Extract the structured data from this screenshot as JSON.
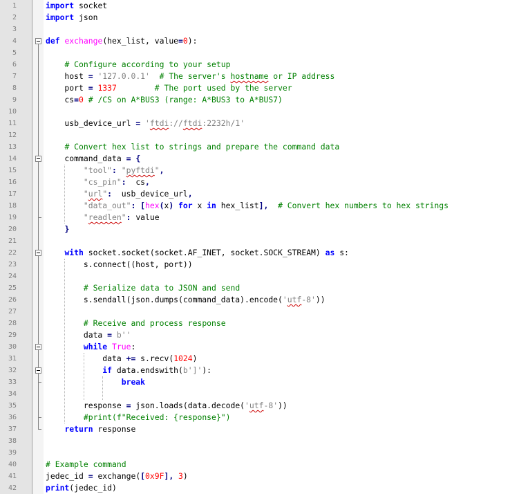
{
  "editor": {
    "line_numbers": [
      "1",
      "2",
      "3",
      "4",
      "5",
      "6",
      "7",
      "8",
      "9",
      "10",
      "11",
      "12",
      "13",
      "14",
      "15",
      "16",
      "17",
      "18",
      "19",
      "20",
      "21",
      "22",
      "23",
      "24",
      "25",
      "26",
      "27",
      "28",
      "29",
      "30",
      "31",
      "32",
      "33",
      "34",
      "35",
      "36",
      "37",
      "38",
      "39",
      "40",
      "41",
      "42"
    ],
    "lines": [
      [
        {
          "t": "kw",
          "v": "import"
        },
        {
          "t": "",
          "v": " socket"
        }
      ],
      [
        {
          "t": "kw",
          "v": "import"
        },
        {
          "t": "",
          "v": " json"
        }
      ],
      [],
      [
        {
          "t": "kw",
          "v": "def"
        },
        {
          "t": "",
          "v": " "
        },
        {
          "t": "fn",
          "v": "exchange"
        },
        {
          "t": "",
          "v": "(hex_list, value"
        },
        {
          "t": "op",
          "v": "="
        },
        {
          "t": "num",
          "v": "0"
        },
        {
          "t": "",
          "v": "):"
        }
      ],
      [],
      [
        {
          "t": "",
          "v": "    "
        },
        {
          "t": "com",
          "v": "# Configure according to your setup"
        }
      ],
      [
        {
          "t": "",
          "v": "    host "
        },
        {
          "t": "op",
          "v": "="
        },
        {
          "t": "",
          "v": " "
        },
        {
          "t": "str",
          "v": "'127.0.0.1'"
        },
        {
          "t": "",
          "v": "  "
        },
        {
          "t": "com",
          "v": "# The server's "
        },
        {
          "t": "com sq",
          "v": "hostname"
        },
        {
          "t": "com",
          "v": " or IP address"
        }
      ],
      [
        {
          "t": "",
          "v": "    port "
        },
        {
          "t": "op",
          "v": "="
        },
        {
          "t": "",
          "v": " "
        },
        {
          "t": "num",
          "v": "1337"
        },
        {
          "t": "",
          "v": "        "
        },
        {
          "t": "com",
          "v": "# The port used by the server"
        }
      ],
      [
        {
          "t": "",
          "v": "    cs"
        },
        {
          "t": "op",
          "v": "="
        },
        {
          "t": "num",
          "v": "0"
        },
        {
          "t": "",
          "v": " "
        },
        {
          "t": "com",
          "v": "# /CS on A*BUS3 (range: A*BUS3 to A*BUS7)"
        }
      ],
      [],
      [
        {
          "t": "",
          "v": "    usb_device_url "
        },
        {
          "t": "op",
          "v": "="
        },
        {
          "t": "",
          "v": " "
        },
        {
          "t": "str",
          "v": "'"
        },
        {
          "t": "str sq",
          "v": "ftdi"
        },
        {
          "t": "str",
          "v": "://"
        },
        {
          "t": "str sq",
          "v": "ftdi"
        },
        {
          "t": "str",
          "v": ":2232h/1'"
        }
      ],
      [],
      [
        {
          "t": "",
          "v": "    "
        },
        {
          "t": "com",
          "v": "# Convert hex list to strings and prepare the command data"
        }
      ],
      [
        {
          "t": "",
          "v": "    command_data "
        },
        {
          "t": "op",
          "v": "="
        },
        {
          "t": "",
          "v": " "
        },
        {
          "t": "op",
          "v": "{"
        }
      ],
      [
        {
          "t": "",
          "v": "        "
        },
        {
          "t": "str",
          "v": "\"tool\""
        },
        {
          "t": "op",
          "v": ":"
        },
        {
          "t": "",
          "v": " "
        },
        {
          "t": "str",
          "v": "\""
        },
        {
          "t": "str sq",
          "v": "pyftdi"
        },
        {
          "t": "str",
          "v": "\""
        },
        {
          "t": "op",
          "v": ","
        }
      ],
      [
        {
          "t": "",
          "v": "        "
        },
        {
          "t": "str",
          "v": "\"cs_pin\""
        },
        {
          "t": "op",
          "v": ":"
        },
        {
          "t": "",
          "v": "  cs"
        },
        {
          "t": "op",
          "v": ","
        }
      ],
      [
        {
          "t": "",
          "v": "        "
        },
        {
          "t": "str",
          "v": "\""
        },
        {
          "t": "str sq",
          "v": "url"
        },
        {
          "t": "str",
          "v": "\""
        },
        {
          "t": "op",
          "v": ":"
        },
        {
          "t": "",
          "v": "  usb_device_url"
        },
        {
          "t": "op",
          "v": ","
        }
      ],
      [
        {
          "t": "",
          "v": "        "
        },
        {
          "t": "str",
          "v": "\"data_out\""
        },
        {
          "t": "op",
          "v": ":"
        },
        {
          "t": "",
          "v": " "
        },
        {
          "t": "op",
          "v": "["
        },
        {
          "t": "fn",
          "v": "hex"
        },
        {
          "t": "op",
          "v": "("
        },
        {
          "t": "",
          "v": "x"
        },
        {
          "t": "op",
          "v": ")"
        },
        {
          "t": "",
          "v": " "
        },
        {
          "t": "kw",
          "v": "for"
        },
        {
          "t": "",
          "v": " x "
        },
        {
          "t": "kw",
          "v": "in"
        },
        {
          "t": "",
          "v": " hex_list"
        },
        {
          "t": "op",
          "v": "],"
        },
        {
          "t": "",
          "v": "  "
        },
        {
          "t": "com",
          "v": "# Convert hex numbers to hex strings"
        }
      ],
      [
        {
          "t": "",
          "v": "        "
        },
        {
          "t": "str",
          "v": "\""
        },
        {
          "t": "str sq",
          "v": "readlen"
        },
        {
          "t": "str",
          "v": "\""
        },
        {
          "t": "op",
          "v": ":"
        },
        {
          "t": "",
          "v": " value"
        }
      ],
      [
        {
          "t": "",
          "v": "    "
        },
        {
          "t": "op",
          "v": "}"
        }
      ],
      [],
      [
        {
          "t": "",
          "v": "    "
        },
        {
          "t": "kw",
          "v": "with"
        },
        {
          "t": "",
          "v": " socket.socket(socket.AF_INET, socket.SOCK_STREAM) "
        },
        {
          "t": "kw",
          "v": "as"
        },
        {
          "t": "",
          "v": " s:"
        }
      ],
      [
        {
          "t": "",
          "v": "        s.connect((host, port))"
        }
      ],
      [],
      [
        {
          "t": "",
          "v": "        "
        },
        {
          "t": "com",
          "v": "# Serialize data to JSON and send"
        }
      ],
      [
        {
          "t": "",
          "v": "        s.sendall(json.dumps(command_data).encode("
        },
        {
          "t": "str",
          "v": "'"
        },
        {
          "t": "str sq",
          "v": "utf"
        },
        {
          "t": "str",
          "v": "-8'"
        },
        {
          "t": "",
          "v": "))"
        }
      ],
      [],
      [
        {
          "t": "",
          "v": "        "
        },
        {
          "t": "com",
          "v": "# Receive and process response"
        }
      ],
      [
        {
          "t": "",
          "v": "        data "
        },
        {
          "t": "op",
          "v": "="
        },
        {
          "t": "",
          "v": " "
        },
        {
          "t": "str",
          "v": "b''"
        }
      ],
      [
        {
          "t": "",
          "v": "        "
        },
        {
          "t": "kw",
          "v": "while"
        },
        {
          "t": "",
          "v": " "
        },
        {
          "t": "fn",
          "v": "True"
        },
        {
          "t": "",
          "v": ":"
        }
      ],
      [
        {
          "t": "",
          "v": "            data "
        },
        {
          "t": "op",
          "v": "+="
        },
        {
          "t": "",
          "v": " s.recv("
        },
        {
          "t": "num",
          "v": "1024"
        },
        {
          "t": "",
          "v": ")"
        }
      ],
      [
        {
          "t": "",
          "v": "            "
        },
        {
          "t": "kw",
          "v": "if"
        },
        {
          "t": "",
          "v": " data.endswith("
        },
        {
          "t": "str",
          "v": "b']'"
        },
        {
          "t": "",
          "v": "):"
        }
      ],
      [
        {
          "t": "",
          "v": "                "
        },
        {
          "t": "kw",
          "v": "break"
        }
      ],
      [],
      [
        {
          "t": "",
          "v": "        response "
        },
        {
          "t": "op",
          "v": "="
        },
        {
          "t": "",
          "v": " json.loads(data.decode("
        },
        {
          "t": "str",
          "v": "'"
        },
        {
          "t": "str sq",
          "v": "utf"
        },
        {
          "t": "str",
          "v": "-8'"
        },
        {
          "t": "",
          "v": "))"
        }
      ],
      [
        {
          "t": "",
          "v": "        "
        },
        {
          "t": "com",
          "v": "#print(f\"Received: {response}\")"
        }
      ],
      [
        {
          "t": "",
          "v": "    "
        },
        {
          "t": "kw",
          "v": "return"
        },
        {
          "t": "",
          "v": " response"
        }
      ],
      [],
      [],
      [
        {
          "t": "com",
          "v": "# Example command"
        }
      ],
      [
        {
          "t": "",
          "v": "jedec_id "
        },
        {
          "t": "op",
          "v": "="
        },
        {
          "t": "",
          "v": " exchange("
        },
        {
          "t": "op",
          "v": "["
        },
        {
          "t": "num",
          "v": "0x9F"
        },
        {
          "t": "op",
          "v": "],"
        },
        {
          "t": "",
          "v": " "
        },
        {
          "t": "num",
          "v": "3"
        },
        {
          "t": "",
          "v": ")"
        }
      ],
      [
        {
          "t": "kw",
          "v": "print"
        },
        {
          "t": "",
          "v": "(jedec_id)"
        }
      ]
    ]
  }
}
